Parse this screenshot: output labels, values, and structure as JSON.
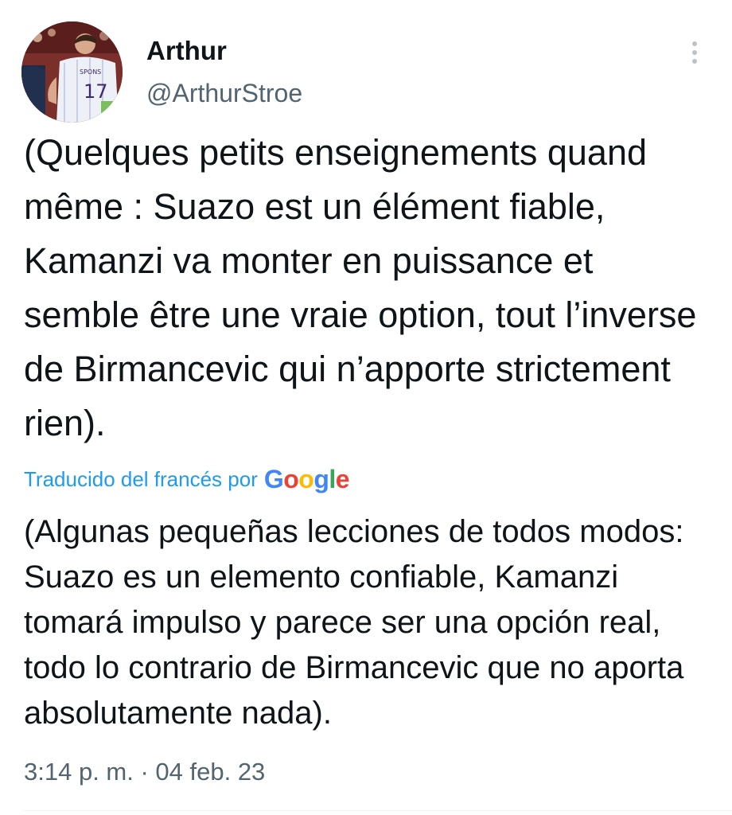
{
  "author": {
    "name": "Arthur",
    "handle": "@ArthurStroe",
    "avatar_icon": "avatar-football-player-photo"
  },
  "tweet": {
    "text": "(Quelques petits enseignements quand même : Suazo est un élément fiable, Kamanzi va monter en puissance et semble être une vraie option, tout l’inverse de Birmancevic qui n’apporte strictement rien).",
    "translation_label": "Traducido del francés por",
    "translation_provider": "Google",
    "translated_text": "(Algunas pequeñas lecciones de todos modos: Suazo es un elemento confiable, Kamanzi tomará impulso y parece ser una opción real, todo lo contrario de Birmancevic que no aporta absolutamente nada).",
    "timestamp": "3:14 p. m. · 04 feb. 23"
  },
  "icons": {
    "more": "more-vertical-icon"
  },
  "colors": {
    "link": "#1d9bf0",
    "secondary_text": "#536471",
    "primary_text": "#0f1419",
    "google_blue": "#4285f4",
    "google_red": "#ea4335",
    "google_yellow": "#fbbc05",
    "google_green": "#34a853"
  }
}
